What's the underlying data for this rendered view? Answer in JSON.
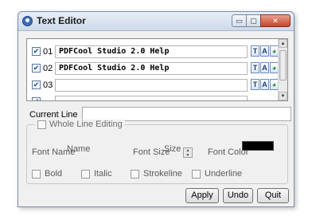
{
  "window": {
    "title": "Text Editor",
    "controls": {
      "minimize": "▭",
      "maximize": "▢",
      "close": "✕"
    }
  },
  "lines": [
    {
      "checked": true,
      "number": "01",
      "text": "PDFCool Studio 2.0 Help"
    },
    {
      "checked": true,
      "number": "02",
      "text": "PDFCool Studio 2.0 Help"
    },
    {
      "checked": true,
      "number": "03",
      "text": ""
    }
  ],
  "line_tools": {
    "text": "T",
    "font": "A",
    "paint": "◕"
  },
  "current_line": {
    "label": "Current Line",
    "value": ""
  },
  "whole_line_editing": {
    "label": "Whole Line Editing",
    "checked": false,
    "font_name_label": "Font Name",
    "font_name_value": "Name",
    "font_size_label": "Font Size",
    "font_size_value": "Size",
    "font_color_label": "Font Color",
    "font_color_value": "#000000",
    "options": [
      {
        "label": "Bold",
        "checked": false
      },
      {
        "label": "Italic",
        "checked": false
      },
      {
        "label": "Strokeline",
        "checked": false
      },
      {
        "label": "Underline",
        "checked": false
      }
    ]
  },
  "buttons": {
    "apply": "Apply",
    "undo": "Undo",
    "quit": "Quit"
  }
}
